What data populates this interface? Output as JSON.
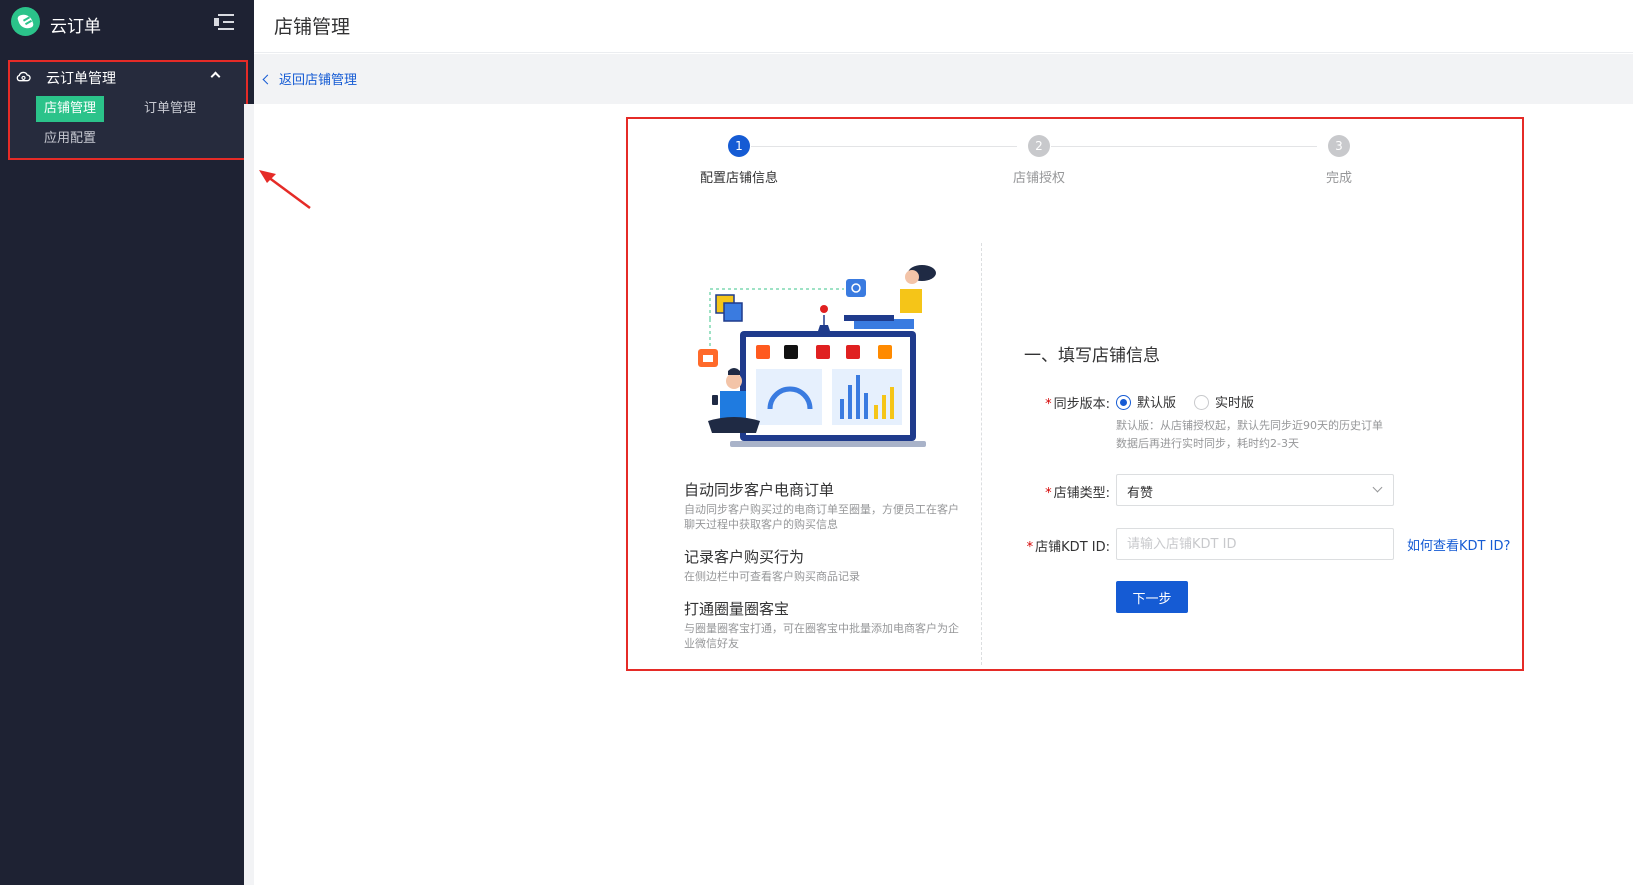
{
  "sidebar": {
    "app_title": "云订单",
    "group": {
      "title": "云订单管理",
      "items": [
        {
          "label": "店铺管理",
          "active": true
        },
        {
          "label": "订单管理",
          "active": false
        },
        {
          "label": "应用配置",
          "active": false
        }
      ]
    }
  },
  "header": {
    "title": "店铺管理"
  },
  "back_link": "返回店铺管理",
  "steps": [
    {
      "num": "1",
      "label": "配置店铺信息",
      "active": true
    },
    {
      "num": "2",
      "label": "店铺授权",
      "active": false
    },
    {
      "num": "3",
      "label": "完成",
      "active": false
    }
  ],
  "features": [
    {
      "title": "自动同步客户电商订单",
      "desc": "自动同步客户购买过的电商订单至圈量，方便员工在客户聊天过程中获取客户的购买信息"
    },
    {
      "title": "记录客户购买行为",
      "desc": "在侧边栏中可查看客户购买商品记录"
    },
    {
      "title": "打通圈量圈客宝",
      "desc": "与圈量圈客宝打通，可在圈客宝中批量添加电商客户为企业微信好友"
    }
  ],
  "form": {
    "title": "一、填写店铺信息",
    "sync_label": "同步版本:",
    "sync_options": [
      "默认版",
      "实时版"
    ],
    "sync_selected": "默认版",
    "sync_help_1": "默认版：从店铺授权起，默认先同步近90天的历史订单",
    "sync_help_2": "数据后再进行实时同步，耗时约2-3天",
    "type_label": "店铺类型:",
    "type_value": "有赞",
    "kdt_label": "店铺KDT ID:",
    "kdt_placeholder": "请输入店铺KDT ID",
    "kdt_value": "",
    "kdt_help_link": "如何查看KDT ID?",
    "next_button": "下一步"
  },
  "colors": {
    "sidebar_bg": "#1e2233",
    "accent_green": "#2bc38a",
    "primary_blue": "#155bd4",
    "annotation_red": "#e52b27"
  }
}
